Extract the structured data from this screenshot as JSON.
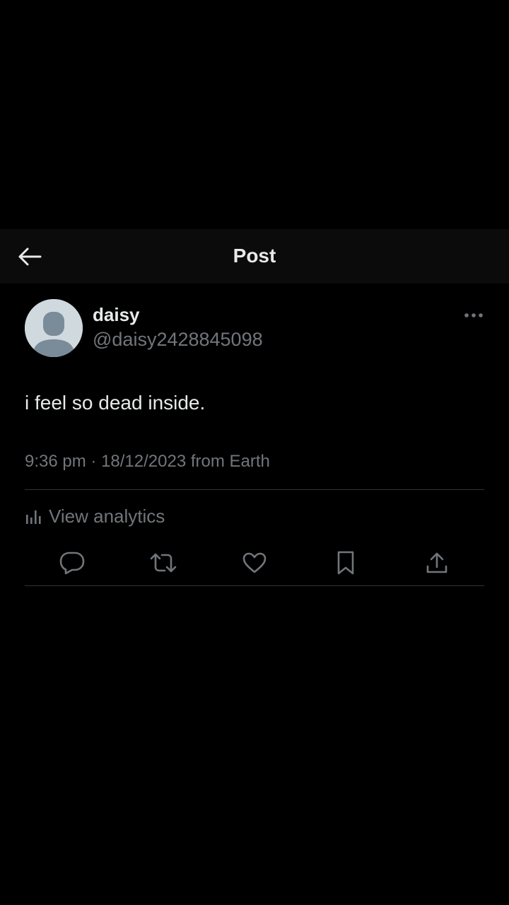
{
  "header": {
    "title": "Post",
    "back_icon": "arrow-left-icon"
  },
  "post": {
    "author": {
      "display_name": "daisy",
      "handle": "@daisy2428845098",
      "avatar_icon": "default-avatar-icon"
    },
    "more_icon": "more-horizontal-icon",
    "text": "i feel so dead inside.",
    "time": "9:36 pm",
    "separator": "·",
    "date": "18/12/2023",
    "source": "from Earth",
    "analytics_label": "View analytics",
    "analytics_icon": "bar-chart-icon"
  },
  "actions": [
    {
      "name": "reply",
      "icon": "reply-icon"
    },
    {
      "name": "repost",
      "icon": "repost-icon"
    },
    {
      "name": "like",
      "icon": "heart-icon"
    },
    {
      "name": "bookmark",
      "icon": "bookmark-icon"
    },
    {
      "name": "share",
      "icon": "share-icon"
    }
  ],
  "colors": {
    "background": "#000000",
    "header_background": "#0b0b0b",
    "primary_text": "#e7e9ea",
    "secondary_text": "#71767b",
    "divider": "#2f3336",
    "avatar_background": "#cfd9de",
    "avatar_silhouette": "#7a8b99"
  }
}
